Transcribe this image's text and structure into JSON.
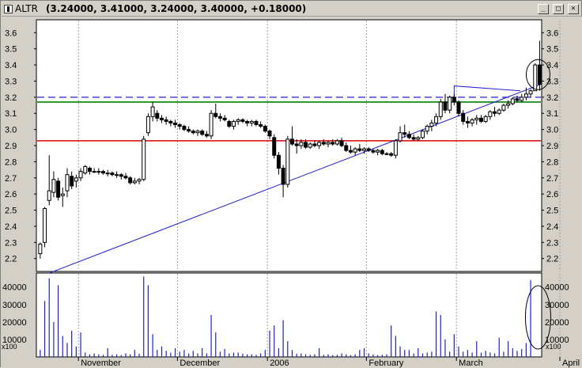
{
  "window": {
    "symbol": "ALTR",
    "quote": "(3.24000, 3.41000, 3.24000, 3.40000, +0.18000)",
    "buttons": [
      "_",
      "□",
      "×"
    ]
  },
  "chart_data": {
    "type": "candlestick",
    "title": "ALTR",
    "price_axis": {
      "ylim": [
        2.12,
        3.68
      ],
      "ticks": [
        "3.6",
        "3.5",
        "3.4",
        "3.3",
        "3.2",
        "3.1",
        "3.0",
        "2.9",
        "2.8",
        "2.7",
        "2.6",
        "2.5",
        "2.4",
        "2.3",
        "2.2"
      ]
    },
    "volume_axis": {
      "ylim": [
        0,
        48000
      ],
      "ticks": [
        "40000",
        "30000",
        "20000",
        "10000"
      ],
      "unit_label": "x100"
    },
    "x_labels": [
      {
        "label": "November",
        "index": 9
      },
      {
        "label": "December",
        "index": 31
      },
      {
        "label": "2006",
        "index": 51
      },
      {
        "label": "February",
        "index": 73
      },
      {
        "label": "March",
        "index": 93
      },
      {
        "label": "April",
        "index": 116
      }
    ],
    "candles": [
      [
        2.23,
        2.3,
        2.2,
        2.29
      ],
      [
        2.3,
        2.52,
        2.27,
        2.51
      ],
      [
        2.56,
        2.84,
        2.53,
        2.62
      ],
      [
        2.61,
        2.74,
        2.58,
        2.69
      ],
      [
        2.68,
        2.7,
        2.56,
        2.58
      ],
      [
        2.59,
        2.64,
        2.52,
        2.6
      ],
      [
        2.62,
        2.76,
        2.58,
        2.72
      ],
      [
        2.71,
        2.74,
        2.63,
        2.65
      ],
      [
        2.68,
        2.72,
        2.64,
        2.7
      ],
      [
        2.7,
        2.76,
        2.68,
        2.74
      ],
      [
        2.73,
        2.78,
        2.72,
        2.77
      ],
      [
        2.76,
        2.77,
        2.72,
        2.74
      ],
      [
        2.74,
        2.76,
        2.73,
        2.74
      ],
      [
        2.74,
        2.76,
        2.72,
        2.74
      ],
      [
        2.74,
        2.75,
        2.72,
        2.73
      ],
      [
        2.73,
        2.75,
        2.71,
        2.73
      ],
      [
        2.73,
        2.74,
        2.71,
        2.72
      ],
      [
        2.72,
        2.74,
        2.7,
        2.72
      ],
      [
        2.72,
        2.73,
        2.69,
        2.71
      ],
      [
        2.71,
        2.73,
        2.69,
        2.7
      ],
      [
        2.7,
        2.71,
        2.66,
        2.67
      ],
      [
        2.67,
        2.7,
        2.66,
        2.68
      ],
      [
        2.68,
        2.7,
        2.66,
        2.69
      ],
      [
        2.69,
        2.96,
        2.68,
        2.94
      ],
      [
        2.98,
        3.1,
        2.96,
        3.08
      ],
      [
        3.08,
        3.17,
        3.05,
        3.14
      ],
      [
        3.1,
        3.12,
        3.05,
        3.07
      ],
      [
        3.07,
        3.09,
        3.04,
        3.06
      ],
      [
        3.06,
        3.08,
        3.03,
        3.05
      ],
      [
        3.05,
        3.06,
        3.02,
        3.04
      ],
      [
        3.04,
        3.06,
        3.01,
        3.03
      ],
      [
        3.03,
        3.04,
        3.0,
        3.02
      ],
      [
        3.02,
        3.03,
        2.99,
        3.0
      ],
      [
        3.0,
        3.02,
        2.98,
        2.99
      ],
      [
        2.99,
        3.0,
        2.97,
        2.98
      ],
      [
        2.98,
        3.0,
        2.96,
        2.99
      ],
      [
        2.99,
        3.0,
        2.96,
        2.97
      ],
      [
        2.97,
        2.99,
        2.95,
        2.96
      ],
      [
        2.96,
        3.12,
        2.94,
        3.1
      ],
      [
        3.1,
        3.16,
        3.07,
        3.08
      ],
      [
        3.08,
        3.1,
        3.05,
        3.07
      ],
      [
        3.07,
        3.09,
        3.05,
        3.06
      ],
      [
        3.05,
        3.06,
        3.01,
        3.02
      ],
      [
        3.02,
        3.06,
        3.0,
        3.05
      ],
      [
        3.05,
        3.07,
        3.03,
        3.06
      ],
      [
        3.06,
        3.07,
        3.04,
        3.05
      ],
      [
        3.05,
        3.06,
        3.02,
        3.04
      ],
      [
        3.04,
        3.06,
        3.02,
        3.05
      ],
      [
        3.05,
        3.06,
        3.02,
        3.03
      ],
      [
        3.03,
        3.05,
        3.01,
        3.02
      ],
      [
        3.02,
        3.03,
        2.98,
        2.99
      ],
      [
        2.99,
        3.0,
        2.94,
        2.96
      ],
      [
        2.95,
        2.97,
        2.82,
        2.84
      ],
      [
        2.84,
        2.86,
        2.72,
        2.76
      ],
      [
        2.76,
        2.78,
        2.58,
        2.66
      ],
      [
        2.66,
        2.96,
        2.64,
        2.94
      ],
      [
        2.94,
        3.02,
        2.9,
        2.91
      ],
      [
        2.91,
        2.94,
        2.85,
        2.9
      ],
      [
        2.9,
        2.94,
        2.88,
        2.92
      ],
      [
        2.92,
        2.94,
        2.88,
        2.89
      ],
      [
        2.89,
        2.92,
        2.88,
        2.91
      ],
      [
        2.91,
        2.93,
        2.89,
        2.9
      ],
      [
        2.9,
        2.93,
        2.88,
        2.92
      ],
      [
        2.92,
        2.94,
        2.9,
        2.91
      ],
      [
        2.91,
        2.93,
        2.89,
        2.92
      ],
      [
        2.92,
        2.94,
        2.9,
        2.91
      ],
      [
        2.91,
        2.94,
        2.9,
        2.93
      ],
      [
        2.93,
        2.95,
        2.89,
        2.9
      ],
      [
        2.9,
        2.92,
        2.86,
        2.87
      ],
      [
        2.87,
        2.9,
        2.85,
        2.86
      ],
      [
        2.86,
        2.89,
        2.84,
        2.88
      ],
      [
        2.88,
        2.91,
        2.86,
        2.87
      ],
      [
        2.87,
        2.89,
        2.85,
        2.88
      ],
      [
        2.88,
        2.89,
        2.86,
        2.87
      ],
      [
        2.87,
        2.88,
        2.85,
        2.86
      ],
      [
        2.86,
        2.88,
        2.84,
        2.87
      ],
      [
        2.87,
        2.88,
        2.84,
        2.85
      ],
      [
        2.85,
        2.86,
        2.84,
        2.85
      ],
      [
        2.85,
        2.86,
        2.83,
        2.84
      ],
      [
        2.84,
        2.94,
        2.82,
        2.93
      ],
      [
        2.93,
        3.02,
        2.92,
        2.98
      ],
      [
        2.98,
        3.03,
        2.95,
        2.97
      ],
      [
        2.97,
        2.99,
        2.94,
        2.95
      ],
      [
        2.95,
        2.97,
        2.93,
        2.94
      ],
      [
        2.94,
        2.96,
        2.93,
        2.95
      ],
      [
        2.95,
        3.0,
        2.94,
        2.99
      ],
      [
        2.99,
        3.03,
        2.97,
        3.02
      ],
      [
        3.02,
        3.06,
        2.99,
        3.04
      ],
      [
        3.04,
        3.1,
        3.02,
        3.08
      ],
      [
        3.08,
        3.19,
        3.06,
        3.17
      ],
      [
        3.17,
        3.22,
        3.1,
        3.12
      ],
      [
        3.12,
        3.21,
        3.1,
        3.2
      ],
      [
        3.2,
        3.22,
        3.15,
        3.17
      ],
      [
        3.17,
        3.18,
        3.08,
        3.1
      ],
      [
        3.1,
        3.12,
        3.03,
        3.05
      ],
      [
        3.05,
        3.08,
        3.01,
        3.04
      ],
      [
        3.04,
        3.07,
        3.02,
        3.06
      ],
      [
        3.06,
        3.09,
        3.03,
        3.07
      ],
      [
        3.07,
        3.09,
        3.04,
        3.05
      ],
      [
        3.05,
        3.09,
        3.04,
        3.08
      ],
      [
        3.08,
        3.12,
        3.06,
        3.11
      ],
      [
        3.11,
        3.14,
        3.08,
        3.1
      ],
      [
        3.1,
        3.13,
        3.09,
        3.12
      ],
      [
        3.12,
        3.16,
        3.11,
        3.15
      ],
      [
        3.15,
        3.18,
        3.13,
        3.16
      ],
      [
        3.16,
        3.2,
        3.15,
        3.19
      ],
      [
        3.19,
        3.21,
        3.17,
        3.18
      ],
      [
        3.18,
        3.22,
        3.17,
        3.2
      ],
      [
        3.2,
        3.26,
        3.18,
        3.22
      ],
      [
        3.22,
        3.25,
        3.2,
        3.24
      ],
      [
        3.24,
        3.41,
        3.24,
        3.4
      ],
      [
        3.4,
        3.55,
        3.24,
        3.28
      ]
    ],
    "volume": [
      4000,
      32000,
      45000,
      20000,
      41000,
      12000,
      8000,
      15000,
      6000,
      14000,
      2500,
      1500,
      2000,
      1500,
      1200,
      5000,
      1200,
      1500,
      1000,
      2000,
      1500,
      4000,
      1800,
      46000,
      41000,
      13000,
      4000,
      6000,
      3500,
      2500,
      5000,
      3000,
      4000,
      2000,
      3500,
      2000,
      5000,
      2000,
      24000,
      14000,
      3000,
      4500,
      2000,
      2500,
      2500,
      1800,
      1500,
      1500,
      1200,
      2000,
      4000,
      15000,
      18000,
      5000,
      21000,
      9000,
      4000,
      1800,
      2000,
      1500,
      1200,
      1500,
      5000,
      1200,
      1500,
      1000,
      1200,
      2000,
      1500,
      1000,
      1500,
      4000,
      5000,
      2000,
      1500,
      1000,
      1200,
      1500,
      18000,
      12000,
      6000,
      4000,
      4000,
      2000,
      5000,
      2000,
      2500,
      3000,
      26000,
      24000,
      10000,
      3000,
      13000,
      6000,
      3000,
      4000,
      2500,
      9000,
      2500,
      3500,
      2500,
      2000,
      11000,
      3000,
      9000,
      5000,
      3500,
      4500,
      8000,
      44000
    ],
    "overlays": [
      {
        "type": "horizontal",
        "y": 3.2,
        "color": "#2020d0",
        "style": "dashed"
      },
      {
        "type": "horizontal",
        "y": 3.17,
        "color": "#008000",
        "style": "solid"
      },
      {
        "type": "horizontal",
        "y": 2.93,
        "color": "#e00000",
        "style": "solid"
      },
      {
        "type": "trendline",
        "y_start": 2.11,
        "y_end": 3.28,
        "color": "#2020d0"
      },
      {
        "type": "trendline",
        "y_start": 3.27,
        "y_end": 3.24,
        "color": "#2020d0"
      }
    ],
    "annotations": [
      "circle around last price candle",
      "circle around last volume bar"
    ],
    "colors": {
      "background": "#ffffff",
      "frame": "#d4d0c8",
      "candle": "#000000",
      "volume": "#2020d0",
      "grid": "#a0a0a0"
    }
  }
}
